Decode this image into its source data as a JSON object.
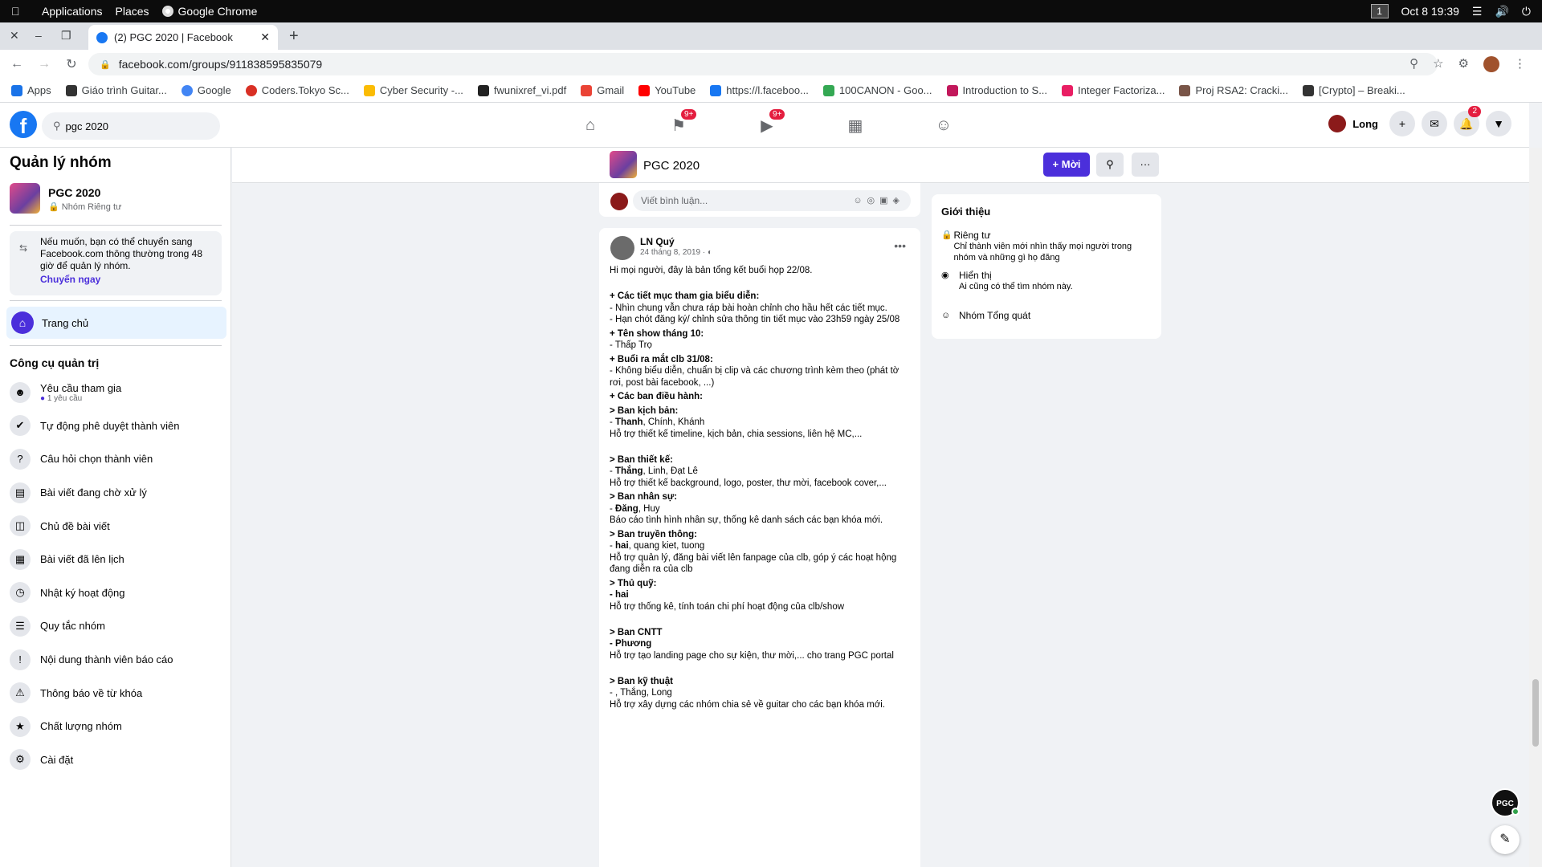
{
  "os": {
    "menus": [
      "Applications",
      "Places",
      "Google Chrome"
    ],
    "workspace": "1",
    "datetime": "Oct 8  19:39"
  },
  "browser": {
    "tab_title": "(2) PGC 2020 | Facebook",
    "url": "facebook.com/groups/911838595835079",
    "bookmarks": [
      "Apps",
      "Giáo trình Guitar...",
      "Google",
      "Coders.Tokyo Sc...",
      "Cyber Security -...",
      "fwunixref_vi.pdf",
      "Gmail",
      "YouTube",
      "https://l.faceboo...",
      "100CANON - Goo...",
      "Introduction to S...",
      "Integer Factoriza...",
      "Proj RSA2: Cracki...",
      "[Crypto] – Breaki..."
    ]
  },
  "fb": {
    "search_value": "pgc 2020",
    "user_name": "Long",
    "badges": {
      "groups": "9+",
      "watch": "9+",
      "notifications": "2"
    }
  },
  "sidebar": {
    "title": "Quản lý nhóm",
    "group_name": "PGC 2020",
    "group_privacy": "Nhóm Riêng tư",
    "notice_text": "Nếu muốn, bạn có thể chuyển sang Facebook.com thông thường trong 48 giờ để quản lý nhóm.",
    "notice_link": "Chuyển ngay",
    "home": "Trang chủ",
    "tools_title": "Công cụ quản trị",
    "tools": [
      {
        "label": "Yêu cầu tham gia",
        "sub": "1 yêu cầu",
        "icon": "person-icon"
      },
      {
        "label": "Tự động phê duyệt thành viên",
        "sub": "",
        "icon": "person-check-icon"
      },
      {
        "label": "Câu hỏi chọn thành viên",
        "sub": "",
        "icon": "question-icon"
      },
      {
        "label": "Bài viết đang chờ xử lý",
        "sub": "",
        "icon": "pending-icon"
      },
      {
        "label": "Chủ đề bài viết",
        "sub": "",
        "icon": "topics-icon"
      },
      {
        "label": "Bài viết đã lên lịch",
        "sub": "",
        "icon": "calendar-icon"
      },
      {
        "label": "Nhật ký hoạt động",
        "sub": "",
        "icon": "clock-icon"
      },
      {
        "label": "Quy tắc nhóm",
        "sub": "",
        "icon": "rules-icon"
      },
      {
        "label": "Nội dung thành viên báo cáo",
        "sub": "",
        "icon": "report-icon"
      },
      {
        "label": "Thông báo về từ khóa",
        "sub": "",
        "icon": "keyword-alert-icon"
      },
      {
        "label": "Chất lượng nhóm",
        "sub": "",
        "icon": "quality-icon"
      },
      {
        "label": "Cài đặt",
        "sub": "",
        "icon": "gear-icon"
      }
    ]
  },
  "group_bar": {
    "name": "PGC 2020",
    "invite": "+ Mời"
  },
  "comment_placeholder": "Viết bình luận...",
  "post": {
    "author": "LN Quý",
    "date": "24 tháng 8, 2019 · ",
    "lines": [
      {
        "t": "Hi mọi người, đây là bản tổng kết buổi họp 22/08."
      },
      {
        "t": ""
      },
      {
        "t": "+ Các tiết mục tham gia biểu diễn:",
        "b": true
      },
      {
        "t": "- Nhìn chung vẫn chưa ráp bài hoàn chỉnh cho hầu hết các tiết mục."
      },
      {
        "t": "- Hạn chót đăng ký/ chỉnh sửa thông tin tiết mục vào 23h59 ngày 25/08"
      },
      {
        "t": "+ Tên show tháng 10:",
        "b": true
      },
      {
        "t": "- Thấp Trọ"
      },
      {
        "t": "+ Buổi ra mắt clb 31/08:",
        "b": true
      },
      {
        "t": "- Không biểu diễn, chuẩn bị clip và các chương trình kèm theo (phát tờ rơi, post bài facebook, ...)"
      },
      {
        "t": "+ Các ban điều hành:",
        "b": true
      },
      {
        "t": "> Ban kịch bản:",
        "b": true
      },
      {
        "t": "- Thanh, Chính, Khánh",
        "bp": "Thanh"
      },
      {
        "t": "Hỗ trợ thiết kế timeline, kịch bản, chia sessions, liên hệ MC,..."
      },
      {
        "t": ""
      },
      {
        "t": "> Ban thiết kế:",
        "b": true
      },
      {
        "t": "- Thắng, Linh, Đạt Lê",
        "bp": "Thắng"
      },
      {
        "t": "Hỗ trợ thiết kế background, logo, poster, thư mời, facebook cover,..."
      },
      {
        "t": "> Ban nhân sự:",
        "b": true
      },
      {
        "t": "- Đăng, Huy",
        "bp": "Đăng"
      },
      {
        "t": "Báo cáo tình hình nhân sự, thống kê danh sách các bạn khóa mới."
      },
      {
        "t": "> Ban truyền thông:",
        "b": true
      },
      {
        "t": "- hai, quang kiet, tuong",
        "bp": "hai"
      },
      {
        "t": "Hỗ trợ quản lý, đăng bài viết lên fanpage của clb, góp ý các hoạt hộng đang diễn ra của clb"
      },
      {
        "t": "> Thủ quỹ:",
        "b": true
      },
      {
        "t": "- hai",
        "b": true
      },
      {
        "t": "Hỗ trợ thống kê, tính toán chi phí hoạt động của clb/show"
      },
      {
        "t": ""
      },
      {
        "t": "> Ban CNTT",
        "b": true
      },
      {
        "t": "- Phương",
        "b": true
      },
      {
        "t": "Hỗ trợ tạo landing page cho sự kiện, thư mời,... cho trang PGC portal"
      },
      {
        "t": ""
      },
      {
        "t": "> Ban kỹ thuật",
        "b": true
      },
      {
        "t": "- , Thắng, Long"
      },
      {
        "t": "Hỗ trợ xây dựng các nhóm chia sẻ về guitar cho các bạn khóa mới."
      }
    ]
  },
  "about": {
    "title": "Giới thiệu",
    "private_title": "Riêng tư",
    "private_desc": "Chỉ thành viên mới nhìn thấy mọi người trong nhóm và những gì họ đăng",
    "visible_title": "Hiển thị",
    "visible_desc": "Ai cũng có thể tìm nhóm này.",
    "general": "Nhóm Tổng quát"
  },
  "floating": {
    "chat_label": "PGC"
  }
}
